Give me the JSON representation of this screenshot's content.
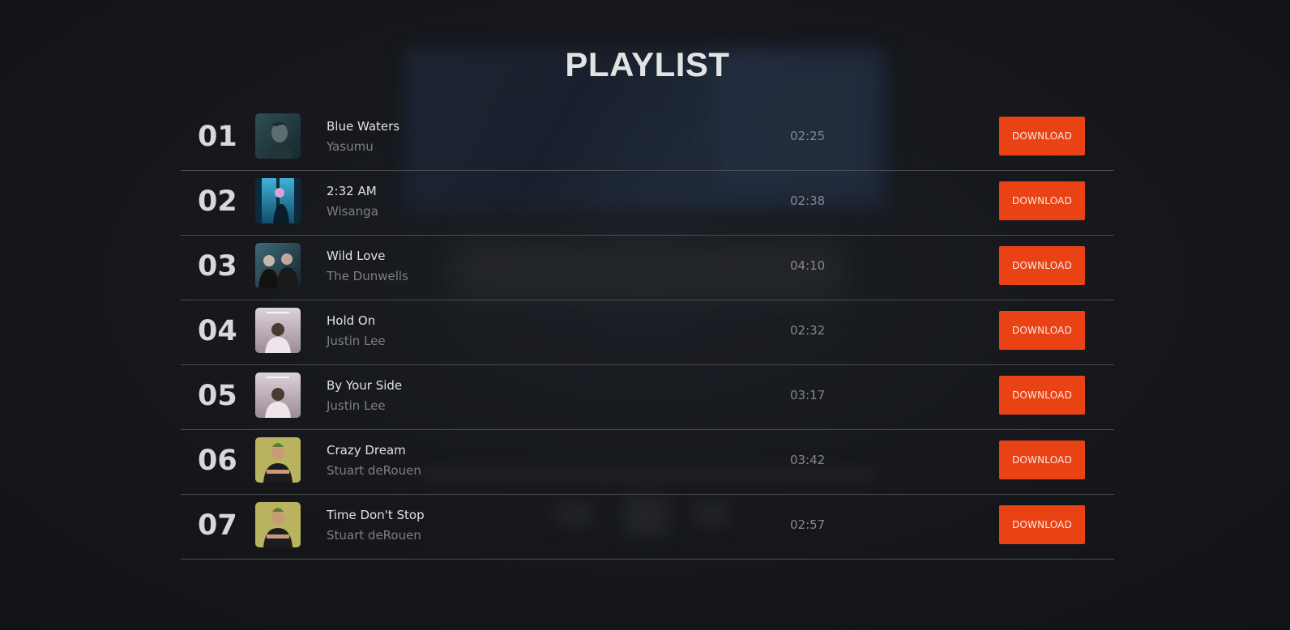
{
  "page": {
    "title": "PLAYLIST"
  },
  "colors": {
    "download_button": "#e84215",
    "background": "#16181d"
  },
  "tracks": [
    {
      "number": "01",
      "title": "Blue Waters",
      "artist": "Yasumu",
      "duration": "02:25",
      "cover": "blue-waters-cover",
      "download_label": "DOWNLOAD"
    },
    {
      "number": "02",
      "title": "2:32 AM",
      "artist": "Wisanga",
      "duration": "02:38",
      "cover": "2-32-am-cover",
      "download_label": "DOWNLOAD"
    },
    {
      "number": "03",
      "title": "Wild Love",
      "artist": "The Dunwells",
      "duration": "04:10",
      "cover": "wild-love-cover",
      "download_label": "DOWNLOAD"
    },
    {
      "number": "04",
      "title": "Hold On",
      "artist": "Justin Lee",
      "duration": "02:32",
      "cover": "hold-on-cover",
      "download_label": "DOWNLOAD"
    },
    {
      "number": "05",
      "title": "By Your Side",
      "artist": "Justin Lee",
      "duration": "03:17",
      "cover": "by-your-side-cover",
      "download_label": "DOWNLOAD"
    },
    {
      "number": "06",
      "title": "Crazy Dream",
      "artist": "Stuart deRouen",
      "duration": "03:42",
      "cover": "crazy-dream-cover",
      "download_label": "DOWNLOAD"
    },
    {
      "number": "07",
      "title": "Time Don't Stop",
      "artist": "Stuart deRouen",
      "duration": "02:57",
      "cover": "time-dont-stop-cover",
      "download_label": "DOWNLOAD"
    }
  ]
}
